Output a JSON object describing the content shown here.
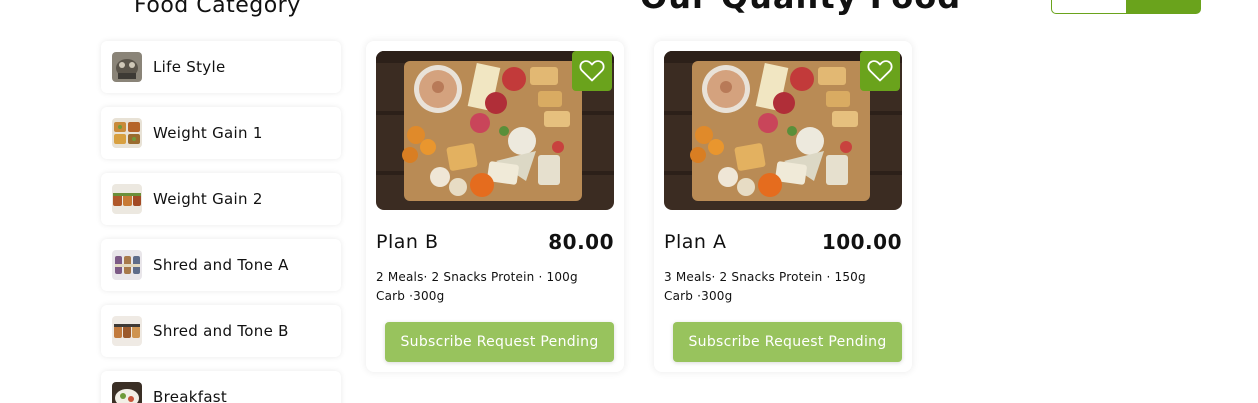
{
  "sidebar": {
    "heading": "Food Category",
    "items": [
      {
        "label": "Life Style"
      },
      {
        "label": "Weight Gain 1"
      },
      {
        "label": "Weight Gain 2"
      },
      {
        "label": "Shred and Tone A"
      },
      {
        "label": "Shred and Tone B"
      },
      {
        "label": "Breakfast"
      }
    ]
  },
  "main": {
    "heading": "Our Quality Food"
  },
  "header": {
    "search_placeholder": ""
  },
  "plans": [
    {
      "name": "Plan B",
      "price": "80.00",
      "desc_line1": "2 Meals· 2 Snacks Protein · 100g",
      "desc_line2": "Carb ·300g",
      "button": "Subscribe Request Pending"
    },
    {
      "name": "Plan A",
      "price": "100.00",
      "desc_line1": "3 Meals· 2 Snacks Protein · 150g",
      "desc_line2": "Carb ·300g",
      "button": "Subscribe Request Pending"
    }
  ],
  "colors": {
    "accent": "#6aa31c",
    "button": "#98c35d"
  },
  "icons": {
    "favorite": "heart-outline-icon"
  }
}
